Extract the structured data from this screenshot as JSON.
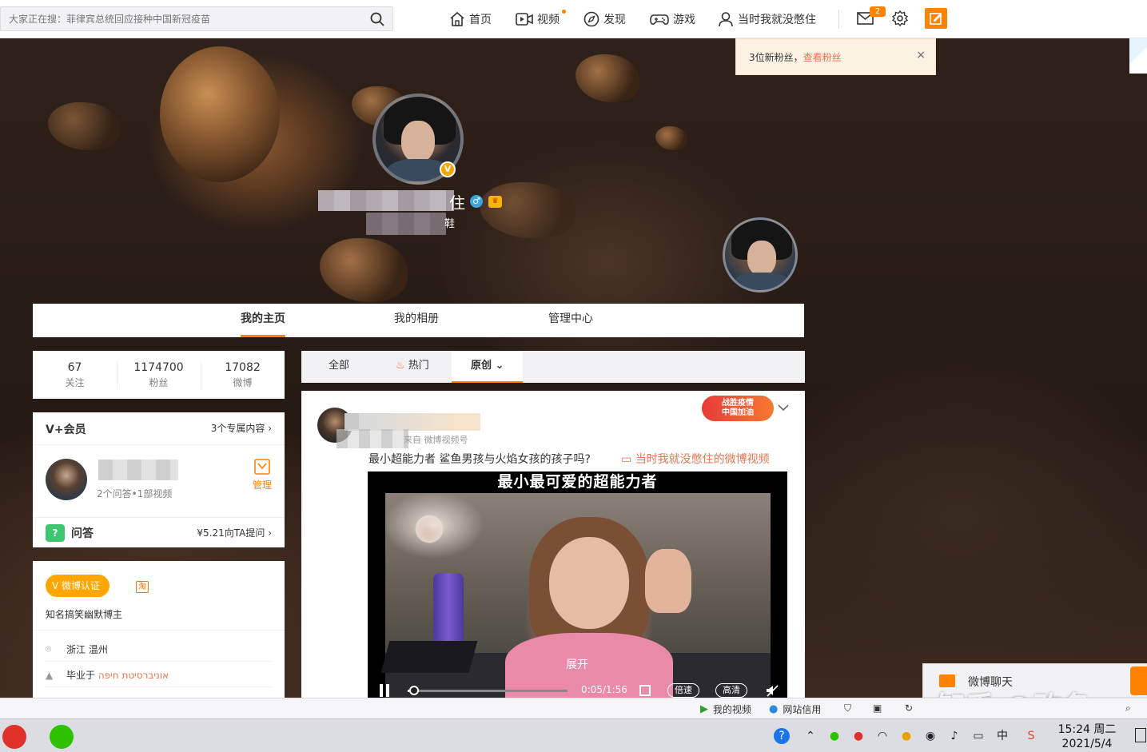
{
  "topnav": {
    "search_placeholder": "大家正在搜：菲律宾总统回应接种中国新冠疫苗",
    "items": [
      {
        "label": "首页",
        "icon": "home-icon"
      },
      {
        "label": "视频",
        "icon": "video-icon"
      },
      {
        "label": "发现",
        "icon": "compass-icon"
      },
      {
        "label": "游戏",
        "icon": "gamepad-icon"
      },
      {
        "label": "当时我就没憋住",
        "icon": "user-icon"
      }
    ],
    "message_badge": "2",
    "accent": "#ff8200"
  },
  "fans_notice": {
    "text": "3位新粉丝，",
    "link": "查看粉丝",
    "close": "×"
  },
  "profile": {
    "name_visible_tail": "住",
    "sub_visible_tail": "鞋",
    "verified": "V",
    "gender": "♂",
    "tabs": [
      "我的主页",
      "我的相册",
      "管理中心"
    ],
    "active_tab": "我的主页"
  },
  "stats": [
    {
      "num": "67",
      "label": "关注"
    },
    {
      "num": "1174700",
      "label": "粉丝"
    },
    {
      "num": "17082",
      "label": "微博"
    }
  ],
  "vip": {
    "title": "V+会员",
    "link": "3个专属内容 ›",
    "desc": "2个问答•1部视频",
    "manage": "管理",
    "qa_label": "问答",
    "qa_link": "¥5.21向TA提问 ›"
  },
  "info": {
    "cert_badge": "微博认证",
    "taobao": "淘",
    "cert_text": "知名搞笑幽默博主",
    "location": "浙江 温州",
    "edu_prefix": "毕业于",
    "edu_link": "אוניברסיטת חיפה"
  },
  "feed": {
    "tabs": [
      "全部",
      "热门",
      "原创"
    ],
    "active_tab": "原创",
    "post": {
      "source": "来自 微博视频号",
      "text": "最小超能力者 鲨鱼男孩与火焰女孩的孩子吗?",
      "link": "当时我就没憋住的微博视频",
      "badge_line1": "战胜疫情",
      "badge_line2": "中国加油",
      "video": {
        "title": "最小最可爱的超能力者",
        "expand": "展开",
        "time": "0:05/1:56",
        "progress": 0.04,
        "speed": "倍速",
        "quality": "高清"
      }
    }
  },
  "chat": {
    "label": "微博聊天"
  },
  "status_bar": [
    {
      "label": "我的视频",
      "icon": "play-icon"
    },
    {
      "label": "网站信用",
      "icon": "drop-icon"
    }
  ],
  "watermark": "知乎 @改名",
  "taskbar": {
    "time": "15:24 周二",
    "date": "2021/5/4",
    "ime": "中"
  }
}
